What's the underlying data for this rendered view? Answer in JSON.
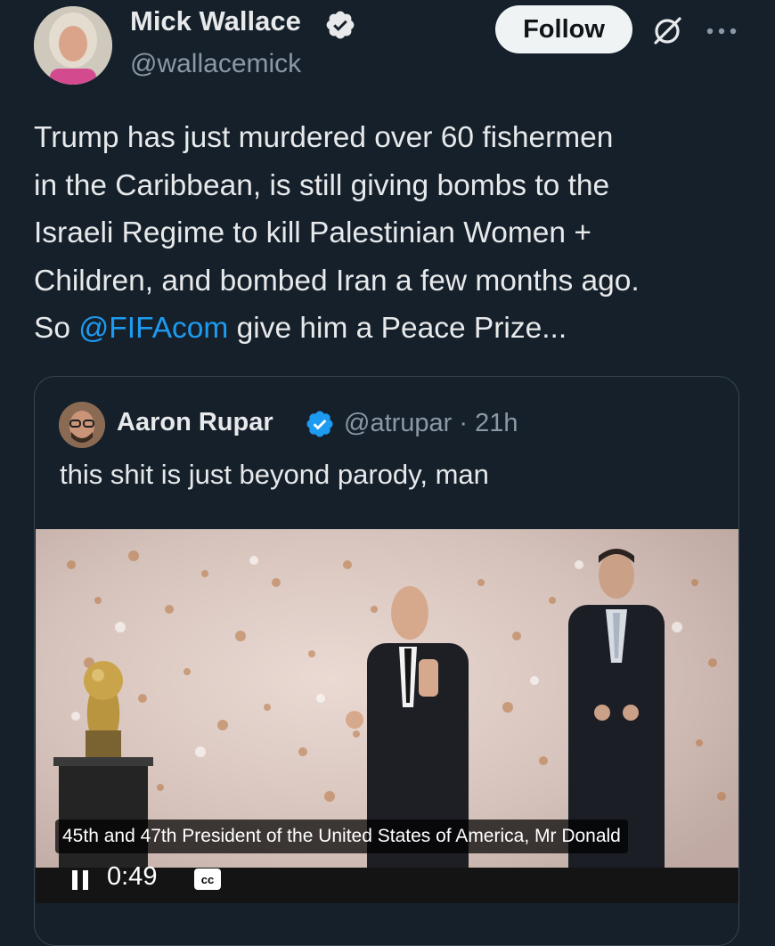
{
  "tweet": {
    "author": {
      "display_name": "Mick Wallace",
      "handle": "@wallacemick",
      "verified": true
    },
    "follow_label": "Follow",
    "text_lines": [
      {
        "text": "Trump has just murdered over 60 fishermen"
      },
      {
        "text": "in the Caribbean, is still giving bombs to the"
      },
      {
        "text": "Israeli Regime to kill Palestinian Women +"
      },
      {
        "text": "Children, and bombed Iran a few months ago."
      },
      {
        "prefix": "So ",
        "mention": "@FIFAcom",
        "suffix": " give him a Peace Prize..."
      }
    ]
  },
  "quote": {
    "author": {
      "display_name": "Aaron Rupar",
      "handle_time": "@atrupar · 21h",
      "verified": true
    },
    "text": "this shit is just beyond parody, man",
    "video": {
      "caption": "45th and 47th President of the United States of America, Mr Donald",
      "time": "0:49",
      "cc_label": "cc"
    }
  },
  "colors": {
    "background": "#15202b",
    "text_primary": "#e7e9ea",
    "text_secondary": "#8b98a5",
    "accent": "#1d9bf0",
    "border": "#38444d"
  }
}
